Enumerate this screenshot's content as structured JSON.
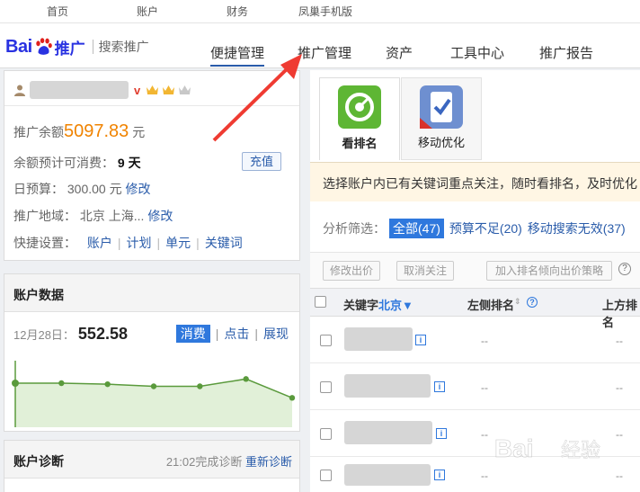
{
  "topbar": {
    "links": [
      "首页",
      "账户",
      "财务",
      "凤巢手机版"
    ]
  },
  "header": {
    "logo_bai": "Bai",
    "logo_tg": "推广",
    "logo_sub": "搜索推广",
    "nav": [
      "便捷管理",
      "推广管理",
      "资产",
      "工具中心",
      "推广报告"
    ],
    "active_nav": "便捷管理"
  },
  "account": {
    "v_badge": "v",
    "balance_label": "推广余额",
    "balance_value": "5097.83",
    "balance_unit": "元",
    "est_label": "余额预计可消费：",
    "est_value": "9 天",
    "charge_button": "充值",
    "budget_label": "日预算：",
    "budget_value": "300.00 元",
    "budget_edit": "修改",
    "region_label": "推广地域：",
    "region_value": "北京 上海...",
    "region_edit": "修改",
    "quick_label": "快捷设置：",
    "quick_links": [
      "账户",
      "计划",
      "单元",
      "关键词"
    ]
  },
  "account_data": {
    "title": "账户数据",
    "date_label": "12月28日：",
    "value": "552.58",
    "tabs": [
      "消费",
      "点击",
      "展现"
    ],
    "active_tab": "消费",
    "chart_data": {
      "type": "area",
      "x": [
        1,
        2,
        3,
        4,
        5,
        6,
        7
      ],
      "values": [
        42,
        42,
        41,
        39,
        39,
        46,
        28
      ],
      "ylim": [
        0,
        60
      ],
      "color": "#5a9a3c",
      "fill": "#e1f0d8",
      "grid": false
    }
  },
  "diagnosis": {
    "title": "账户诊断",
    "status": "21:02完成诊断",
    "rediagnose": "重新诊断"
  },
  "tools": [
    {
      "label": "看排名",
      "icon": "target-icon"
    },
    {
      "label": "移动优化",
      "icon": "mobile-optimize-icon"
    }
  ],
  "notice": "选择账户内已有关键词重点关注，随时看排名，及时优化",
  "filter": {
    "label": "分析筛选：",
    "options": [
      "全部(47)",
      "预算不足(20)",
      "移动搜索无效(37)"
    ]
  },
  "actions": [
    "修改出价",
    "取消关注",
    "加入排名倾向出价策略"
  ],
  "table": {
    "columns": {
      "keyword": "关键字",
      "region": "北京▼",
      "left_rank": "左侧排名",
      "top_rank": "上方排名"
    },
    "rows": [
      {
        "left": "--",
        "top": "--"
      },
      {
        "left": "--",
        "top": "--"
      },
      {
        "left": "--",
        "top": "--"
      },
      {
        "left": "--",
        "top": "--"
      }
    ]
  },
  "colors": {
    "brand_blue": "#2932e1",
    "link_blue": "#2a5caa",
    "accent_orange": "#f08300",
    "chart_green": "#5a9a3c",
    "arrow_red": "#ef3b32"
  }
}
